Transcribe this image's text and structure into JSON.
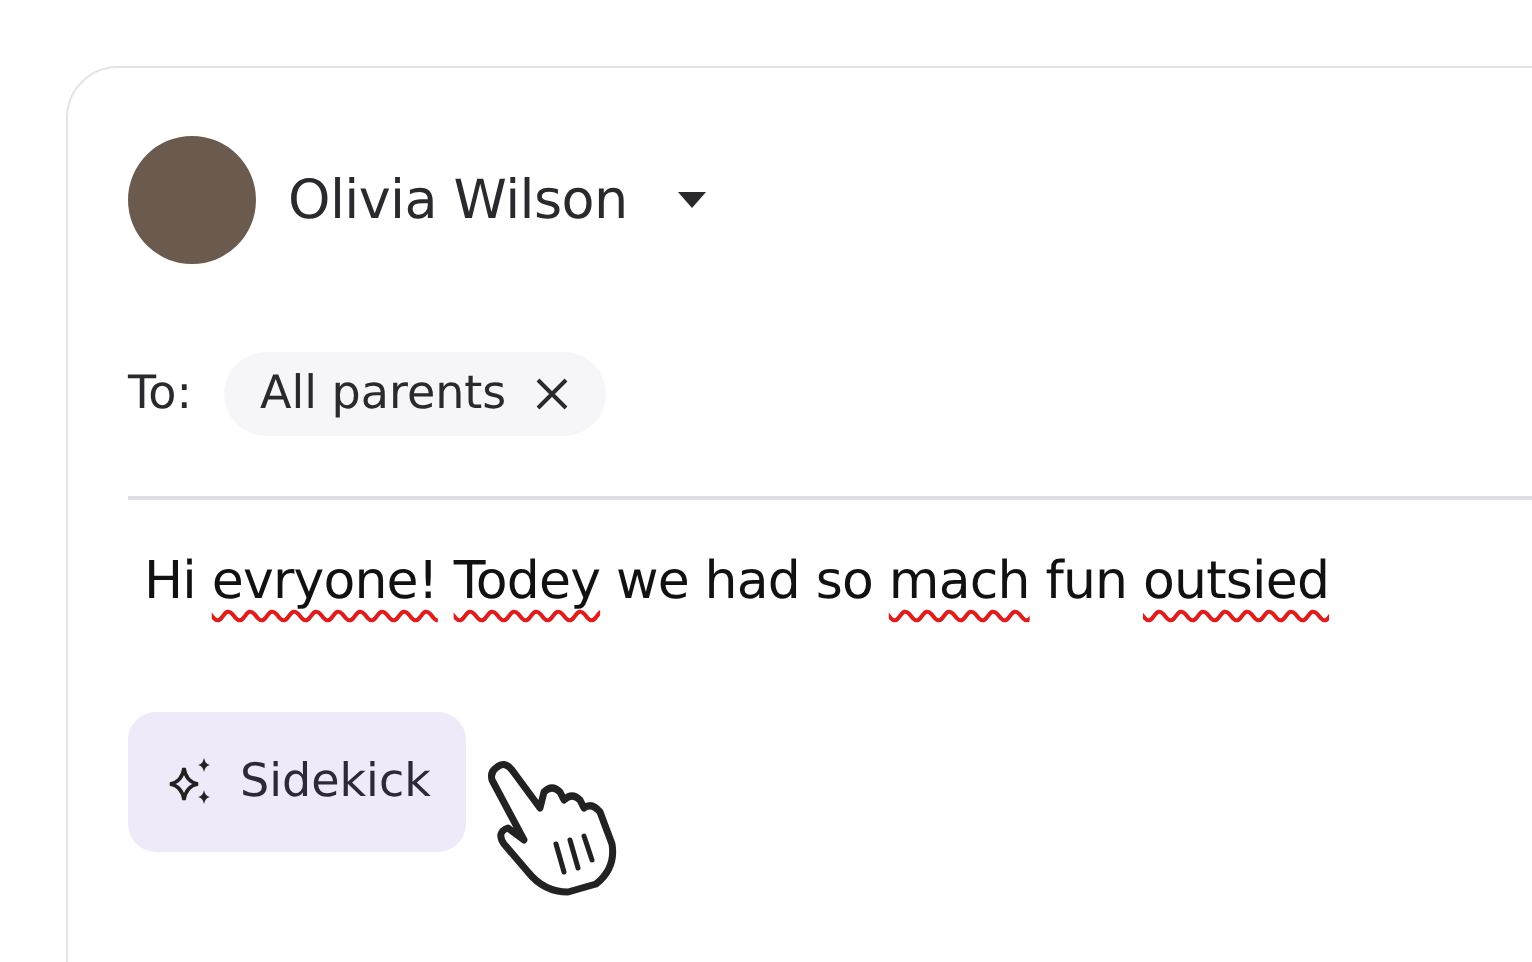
{
  "sender": {
    "name": "Olivia Wilson"
  },
  "recipients": {
    "label": "To:",
    "chips": [
      {
        "text": "All parents"
      }
    ]
  },
  "message": {
    "words": [
      {
        "text": "Hi",
        "misspelled": false
      },
      {
        "text": "evryone!",
        "misspelled": true
      },
      {
        "text": "Todey",
        "misspelled": true
      },
      {
        "text": "we had so",
        "misspelled": false
      },
      {
        "text": "mach",
        "misspelled": true
      },
      {
        "text": "fun",
        "misspelled": false
      },
      {
        "text": "outsied",
        "misspelled": true
      }
    ]
  },
  "sidekick_button": {
    "label": "Sidekick"
  }
}
